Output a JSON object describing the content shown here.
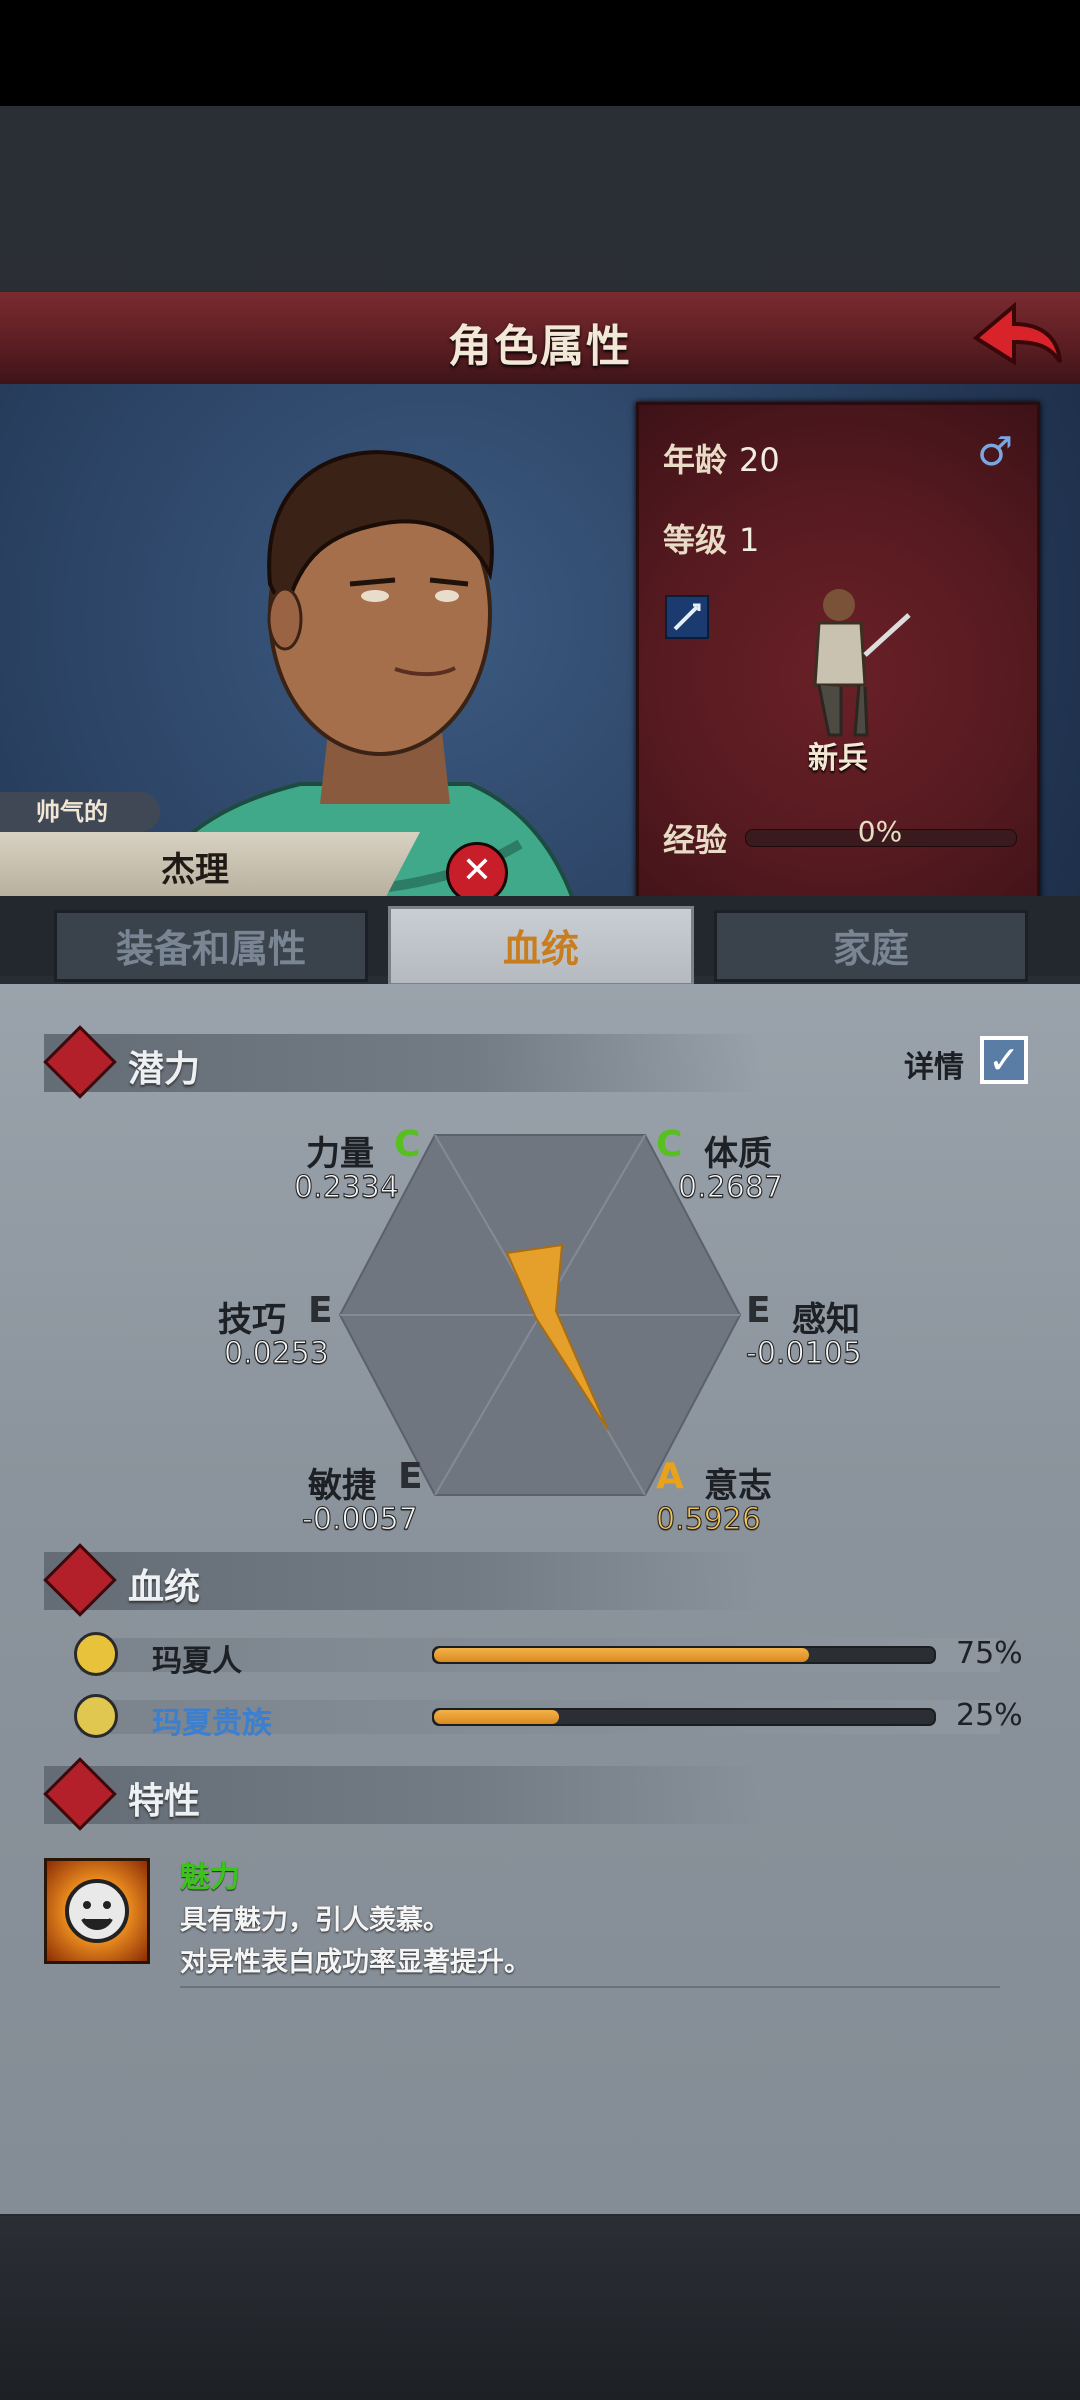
{
  "header": {
    "title": "角色属性"
  },
  "character": {
    "trait_tag": "帅气的",
    "name": "杰理",
    "age_label": "年龄",
    "age": "20",
    "gender_symbol": "♂",
    "level_label": "等级",
    "level": "1",
    "class": "新兵",
    "exp_label": "经验",
    "exp_pct": "0%",
    "exp_fraction": 0
  },
  "tabs": [
    {
      "label": "装备和属性",
      "active": false
    },
    {
      "label": "血统",
      "active": true
    },
    {
      "label": "家庭",
      "active": false
    }
  ],
  "potential": {
    "title": "潜力",
    "detail_label": "详情",
    "detail_checked": true,
    "stats": [
      {
        "name": "力量",
        "grade": "C",
        "value": "0.2334"
      },
      {
        "name": "体质",
        "grade": "C",
        "value": "0.2687"
      },
      {
        "name": "技巧",
        "grade": "E",
        "value": "0.0253"
      },
      {
        "name": "感知",
        "grade": "E",
        "value": "-0.0105"
      },
      {
        "name": "敏捷",
        "grade": "E",
        "value": "-0.0057"
      },
      {
        "name": "意志",
        "grade": "A",
        "value": "0.5926"
      }
    ]
  },
  "bloodline": {
    "title": "血统",
    "items": [
      {
        "name": "玛夏人",
        "pct": "75%",
        "fraction": 0.75
      },
      {
        "name": "玛夏贵族",
        "pct": "25%",
        "fraction": 0.25
      }
    ]
  },
  "traits": {
    "title": "特性",
    "items": [
      {
        "name": "魅力",
        "desc1": "具有魅力，引人羡慕。",
        "desc2": "对异性表白成功率显著提升。"
      }
    ]
  },
  "colors": {
    "grade_C": "#56c01f",
    "grade_E": "#2a2e33",
    "grade_A": "#e8a21c",
    "accent": "#c87e20",
    "bloodline_highlight": "#3a7fd0"
  }
}
